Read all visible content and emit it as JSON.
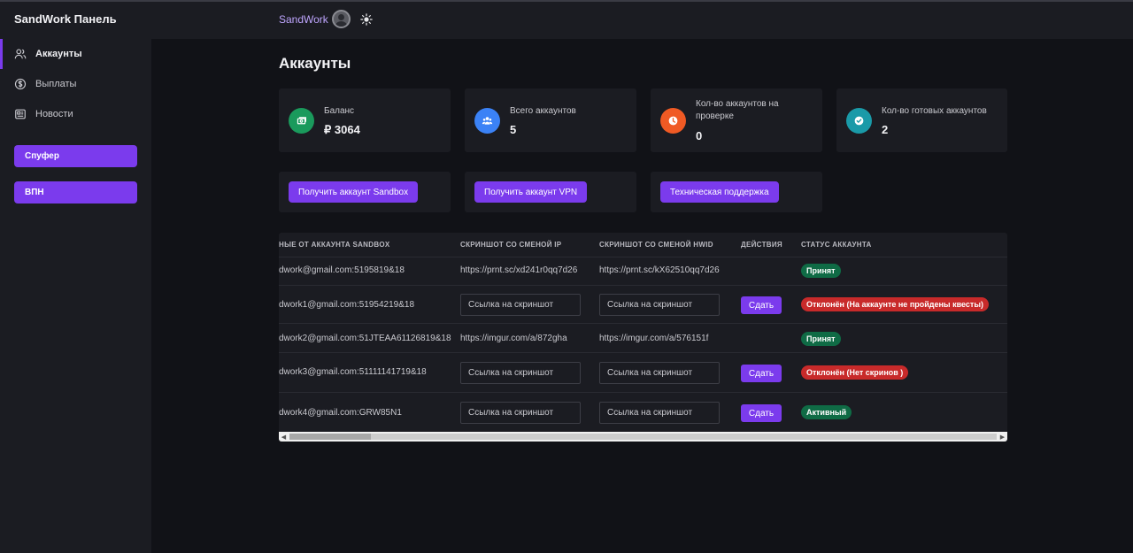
{
  "header": {
    "brand": "SandWork Панель",
    "username": "SandWork"
  },
  "sidebar": {
    "items": [
      {
        "label": "Аккаунты",
        "icon": "users-icon",
        "active": true
      },
      {
        "label": "Выплаты",
        "icon": "dollar-circle-icon",
        "active": false
      },
      {
        "label": "Новости",
        "icon": "newspaper-icon",
        "active": false
      }
    ],
    "buttons": [
      {
        "label": "Спуфер"
      },
      {
        "label": "ВПН"
      }
    ]
  },
  "page": {
    "title": "Аккаунты"
  },
  "stats": [
    {
      "label": "Баланс",
      "value": "₽ 3064",
      "icon": "cash-icon",
      "color": "#1a9a5c"
    },
    {
      "label": "Всего аккаунтов",
      "value": "5",
      "icon": "group-icon",
      "color": "#3b82f6"
    },
    {
      "label_line1": "Кол-во аккаунтов на",
      "label_line2": "проверке",
      "value": "0",
      "icon": "clock-icon",
      "color": "#f05a24"
    },
    {
      "label": "Кол-во готовых аккаунтов",
      "value": "2",
      "icon": "check-badge-icon",
      "color": "#1a9aa8"
    }
  ],
  "actions": [
    {
      "label": "Получить аккаунт Sandbox"
    },
    {
      "label": "Получить аккаунт VPN"
    },
    {
      "label": "Техническая поддержка"
    }
  ],
  "table": {
    "headers": [
      "НЫЕ ОТ АККАУНТА SANDBOX",
      "СКРИНШОТ СО СМЕНОЙ IP",
      "СКРИНШОТ СО СМЕНОЙ HWID",
      "ДЕЙСТВИЯ",
      "СТАТУС АККАУНТА"
    ],
    "input_placeholder": "Ссылка на скриншот",
    "submit_label": "Сдать",
    "rows": [
      {
        "account": "dwork@gmail.com:5195819&18",
        "ip": "https://prnt.sc/xd241r0qq7d26",
        "hwid": "https://prnt.sc/kX62510qq7d26",
        "status": "Принят",
        "status_type": "ok"
      },
      {
        "account": "dwork1@gmail.com:51954219&18",
        "status": "Отклонён (На аккаунте не пройдены квесты)",
        "status_type": "bad"
      },
      {
        "account": "dwork2@gmail.com:51JTEAA61126819&18",
        "ip": "https://imgur.com/a/872gha",
        "hwid": "https://imgur.com/a/576151f",
        "status": "Принят",
        "status_type": "ok"
      },
      {
        "account": "dwork3@gmail.com:51111141719&18",
        "status": "Отклонён (Нет скринов )",
        "status_type": "bad"
      },
      {
        "account": "dwork4@gmail.com:GRW85N1",
        "status": "Активный",
        "status_type": "ok"
      }
    ]
  }
}
